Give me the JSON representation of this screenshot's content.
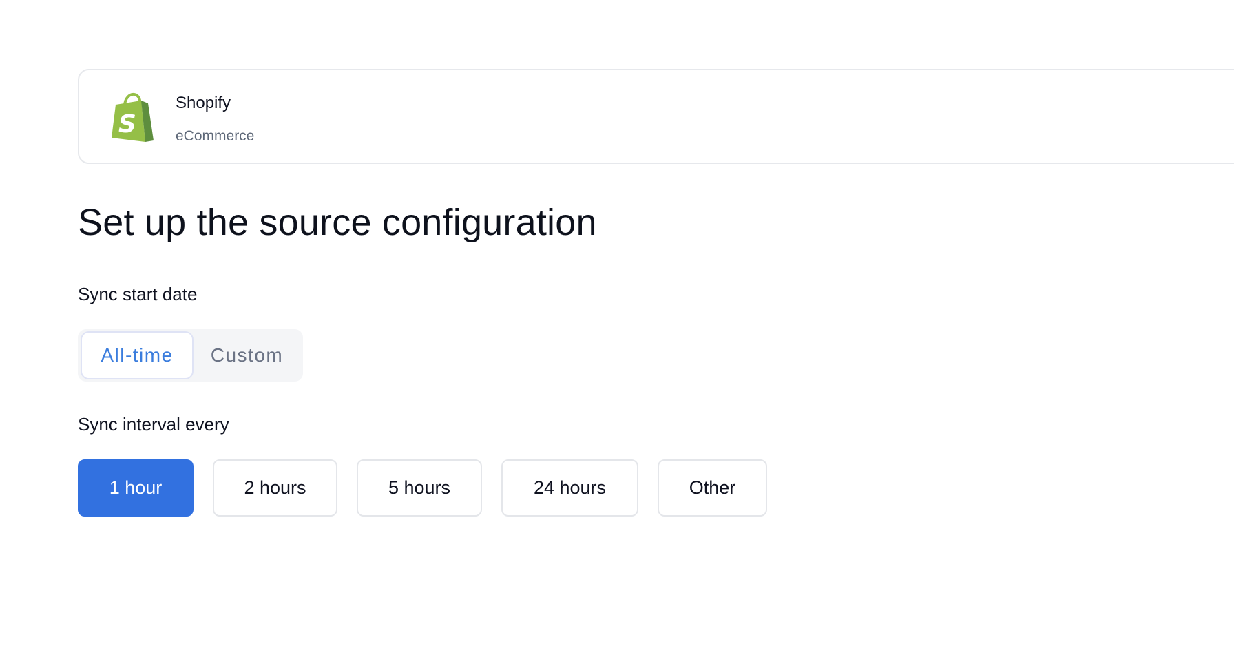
{
  "source": {
    "name": "Shopify",
    "category": "eCommerce",
    "logo_icon": "shopify-bag-logo",
    "brand_colors": {
      "bag_light": "#95bf47",
      "bag_dark": "#5e8e3e",
      "letter": "#ffffff"
    }
  },
  "page": {
    "title": "Set up the source configuration"
  },
  "sync_start": {
    "label": "Sync start date",
    "options": [
      {
        "label": "All-time",
        "selected": true
      },
      {
        "label": "Custom",
        "selected": false
      }
    ]
  },
  "sync_interval": {
    "label": "Sync interval every",
    "options": [
      {
        "label": "1 hour",
        "selected": true
      },
      {
        "label": "2 hours",
        "selected": false
      },
      {
        "label": "5 hours",
        "selected": false
      },
      {
        "label": "24 hours",
        "selected": false
      },
      {
        "label": "Other",
        "selected": false
      }
    ]
  },
  "colors": {
    "accent": "#3271e0",
    "accent_text": "#3b7ddd",
    "border": "#e4e6ea",
    "muted_text": "#5e6878"
  }
}
